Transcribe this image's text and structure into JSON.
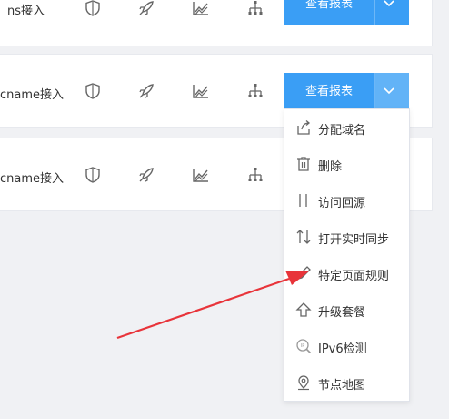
{
  "rows": [
    {
      "label": "ns接入",
      "button": "查看报表"
    },
    {
      "label": "cname接入",
      "button": "查看报表"
    },
    {
      "label": "cname接入"
    }
  ],
  "icons": {
    "shield": "shield-icon",
    "rocket": "rocket-icon",
    "chart": "line-chart-icon",
    "tree": "node-tree-icon",
    "caret": "chevron-down-icon"
  },
  "menu": {
    "items": [
      {
        "label": "分配域名",
        "icon": "share-icon"
      },
      {
        "label": "删除",
        "icon": "trash-icon"
      },
      {
        "label": "访问回源",
        "icon": "origin-icon"
      },
      {
        "label": "打开实时同步",
        "icon": "sync-icon"
      },
      {
        "label": "特定页面规则",
        "icon": "pen-icon"
      },
      {
        "label": "升级套餐",
        "icon": "upgrade-icon"
      },
      {
        "label": "IPv6检测",
        "icon": "ipv6-icon"
      },
      {
        "label": "节点地图",
        "icon": "map-pin-icon"
      }
    ]
  },
  "colors": {
    "primary": "#3a9ef5",
    "caret_active": "#62b3f7",
    "annotation_arrow": "#e8343a",
    "icon_gray": "#666666"
  }
}
